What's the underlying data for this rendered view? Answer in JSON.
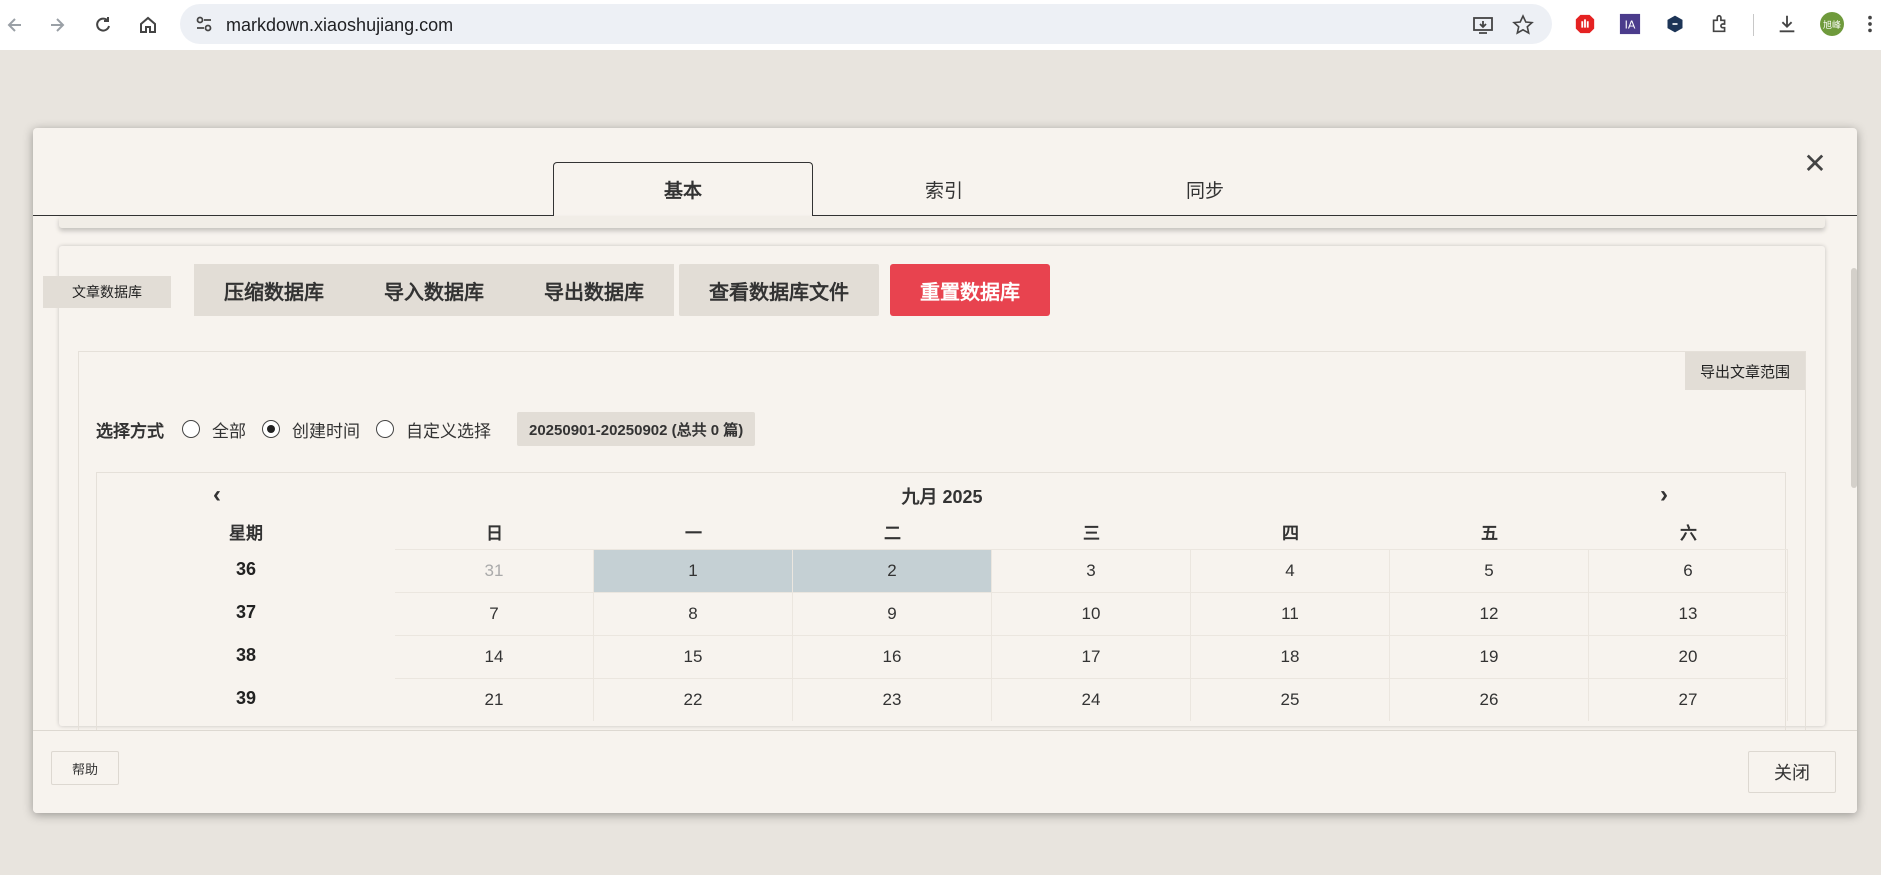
{
  "browser": {
    "url": "markdown.xiaoshujiang.com",
    "avatar_text": "旭峰"
  },
  "modal": {
    "tabs": [
      {
        "label": "基本",
        "active": true
      },
      {
        "label": "索引",
        "active": false
      },
      {
        "label": "同步",
        "active": false
      }
    ],
    "close_symbol": "✕"
  },
  "database": {
    "label": "文章数据库",
    "buttons": {
      "compress": "压缩数据库",
      "import": "导入数据库",
      "export": "导出数据库",
      "view_file": "查看数据库文件",
      "reset": "重置数据库"
    },
    "reset_color": "#e8434f"
  },
  "export_range": {
    "title": "导出文章范围",
    "select_label": "选择方式",
    "options": [
      {
        "label": "全部",
        "checked": false
      },
      {
        "label": "创建时间",
        "checked": true
      },
      {
        "label": "自定义选择",
        "checked": false
      }
    ],
    "range_text": "20250901-20250902 (总共 0 篇)"
  },
  "calendar": {
    "title": "九月 2025",
    "prev_symbol": "‹",
    "next_symbol": "›",
    "week_header": "星期",
    "day_headers": [
      "日",
      "一",
      "二",
      "三",
      "四",
      "五",
      "六"
    ],
    "weeks": [
      {
        "week": "36",
        "days": [
          "31",
          "1",
          "2",
          "3",
          "4",
          "5",
          "6"
        ]
      },
      {
        "week": "37",
        "days": [
          "7",
          "8",
          "9",
          "10",
          "11",
          "12",
          "13"
        ]
      },
      {
        "week": "38",
        "days": [
          "14",
          "15",
          "16",
          "17",
          "18",
          "19",
          "20"
        ]
      },
      {
        "week": "39",
        "days": [
          "21",
          "22",
          "23",
          "24",
          "25",
          "26",
          "27"
        ]
      }
    ],
    "selected_color": "#c5d0d4"
  },
  "footer": {
    "help_label": "帮助",
    "close_label": "关闭"
  }
}
